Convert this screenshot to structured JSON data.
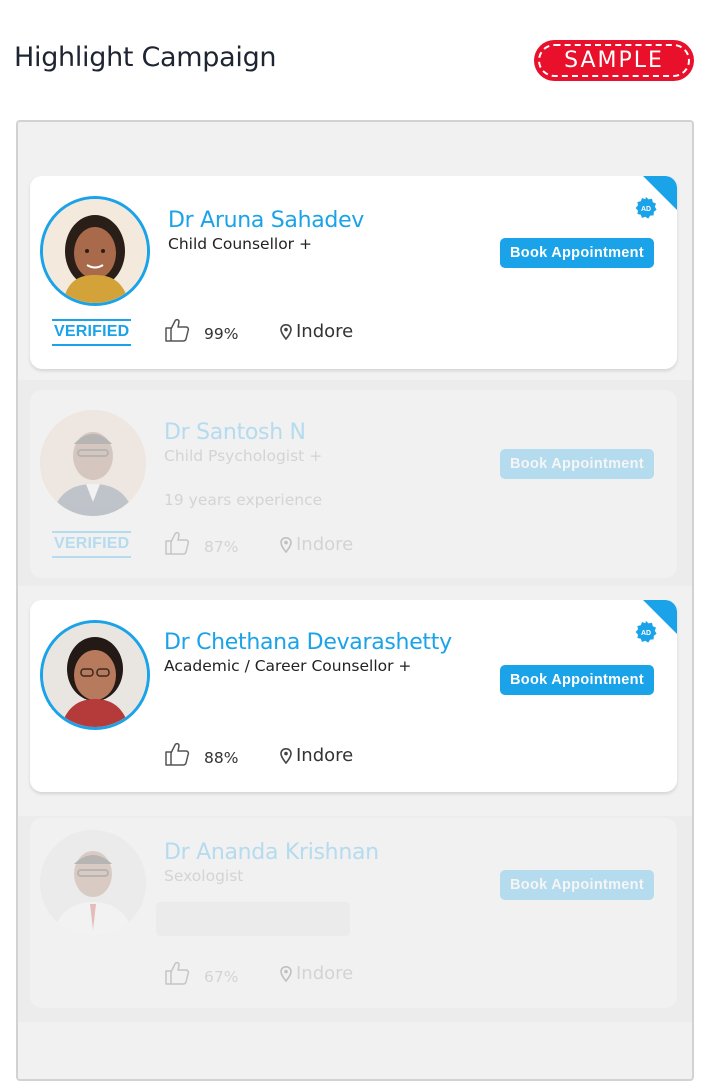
{
  "page": {
    "title": "Highlight Campaign",
    "sample_label": "SAMPLE"
  },
  "colors": {
    "accent": "#1aa3e8",
    "sample_red": "#e8102a",
    "panel_bg": "#f1f1f1"
  },
  "doctors": [
    {
      "name": "Dr Aruna Sahadev",
      "specialty": "Child Counsellor +",
      "experience": "",
      "verified": "VERIFIED",
      "rating": "99%",
      "location": "Indore",
      "book_label": "Book Appointment",
      "ad_label": "AD",
      "sponsored": true
    },
    {
      "name": "Dr Santosh N",
      "specialty": "Child Psychologist +",
      "experience": "19 years experience",
      "verified": "VERIFIED",
      "rating": "87%",
      "location": "Indore",
      "book_label": "Book Appointment",
      "sponsored": false
    },
    {
      "name": "Dr Chethana Devarashetty",
      "specialty": "Academic / Career Counsellor +",
      "experience": "",
      "rating": "88%",
      "location": "Indore",
      "book_label": "Book Appointment",
      "ad_label": "AD",
      "sponsored": true
    },
    {
      "name": "Dr Ananda Krishnan",
      "specialty": "Sexologist",
      "experience": "",
      "rating": "67%",
      "location": "Indore",
      "book_label": "Book Appointment",
      "sponsored": false
    }
  ],
  "icons": {
    "rating": "thumbs-up-icon",
    "location": "map-pin-icon",
    "sponsored": "ad-badge-icon"
  }
}
